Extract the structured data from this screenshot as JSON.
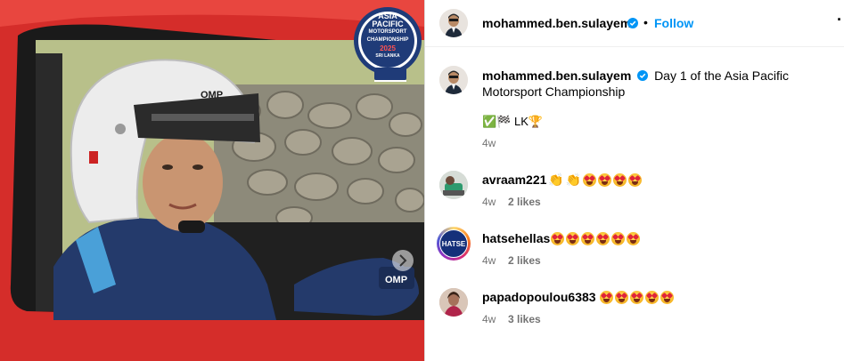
{
  "photo": {
    "badge_lines": [
      "ASIA",
      "PACIFIC",
      "MOTORSPORT",
      "CHAMPIONSHIP",
      "2025",
      "SRI LANKA"
    ],
    "helmet_brand": "OMP",
    "suit_brand": "OMP",
    "colors": {
      "car": "#d52d2a",
      "helmet": "#ececec",
      "suit": "#243a6b"
    }
  },
  "header": {
    "username": "mohammed.ben.sulayem",
    "separator": "•",
    "follow_label": "Follow",
    "more_label": "···"
  },
  "caption": {
    "username": "mohammed.ben.sulayem",
    "text": "Day 1 of the Asia Pacific Motorsport Championship",
    "emoji_line": "✅🏁 LK🏆",
    "time": "4w"
  },
  "comments": [
    {
      "username": "avraam221",
      "emoji": [
        "clap",
        "clap",
        "grin",
        "grin",
        "grin",
        "grin"
      ],
      "time": "4w",
      "likes": "2 likes"
    },
    {
      "username": "hatsehellas",
      "avatar_text": "HATSE",
      "emoji": [
        "grin",
        "grin",
        "grin",
        "grin",
        "grin",
        "grin"
      ],
      "time": "4w",
      "likes": "2 likes"
    },
    {
      "username": "papadopoulou6383",
      "emoji": [
        "grin",
        "grin",
        "grin",
        "grin",
        "grin"
      ],
      "time": "4w",
      "likes": "3 likes"
    }
  ],
  "colors": {
    "accent": "#0095f6",
    "verified": "#0095f6",
    "muted": "#737373"
  }
}
